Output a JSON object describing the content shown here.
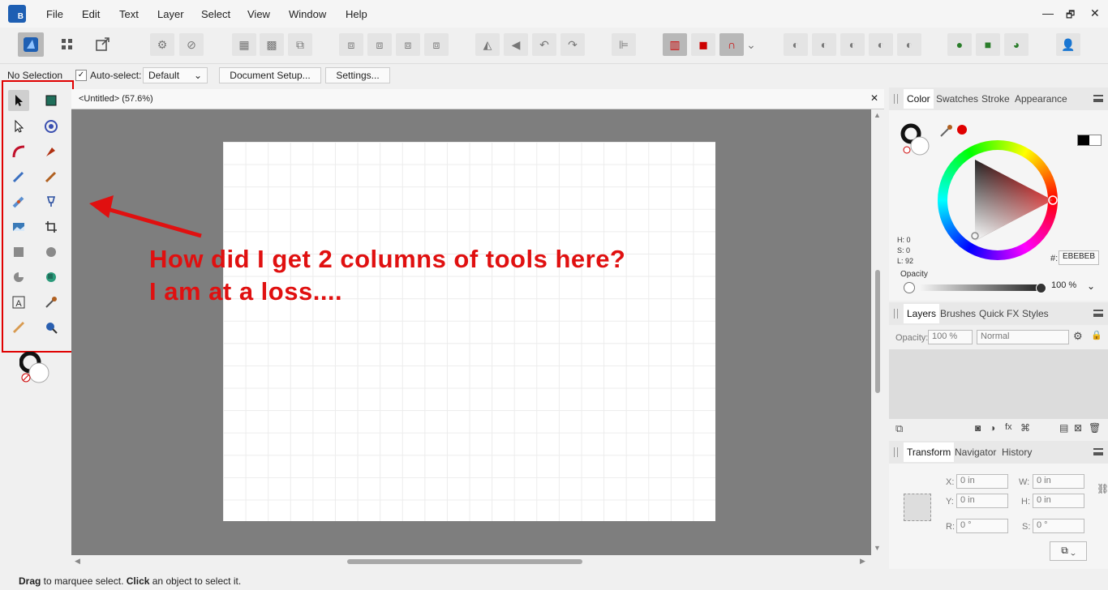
{
  "menu": [
    "File",
    "Edit",
    "Text",
    "Layer",
    "Select",
    "View",
    "Window",
    "Help"
  ],
  "window_controls": {
    "minimize": "—",
    "restore": "🗗",
    "close": "✕"
  },
  "context_bar": {
    "selection": "No Selection",
    "auto_select_label": "Auto-select:",
    "auto_select_value": "Default",
    "document_setup": "Document Setup...",
    "settings": "Settings..."
  },
  "document": {
    "tab_title": "<Untitled>  (57.6%)",
    "close": "✕"
  },
  "annotation": {
    "line1": "How did I get 2 columns of tools here?",
    "line2": "I am at a loss...."
  },
  "status": {
    "drag": "Drag",
    "text1": " to marquee select. ",
    "click": "Click",
    "text2": " an object to select it."
  },
  "color_panel": {
    "tabs": [
      "Color",
      "Swatches",
      "Stroke",
      "Appearance"
    ],
    "h": "H: 0",
    "s": "S: 0",
    "l": "L: 92",
    "hex_label": "#:",
    "hex_value": "EBEBEB",
    "opacity_label": "Opacity",
    "opacity_value": "100 %"
  },
  "layers_panel": {
    "tabs": [
      "Layers",
      "Brushes",
      "Quick FX",
      "Styles"
    ],
    "opacity_label": "Opacity:",
    "opacity_value": "100 %",
    "blend_mode": "Normal"
  },
  "transform_panel": {
    "tabs": [
      "Transform",
      "Navigator",
      "History"
    ],
    "x_label": "X:",
    "x_value": "0 in",
    "y_label": "Y:",
    "y_value": "0 in",
    "w_label": "W:",
    "w_value": "0 in",
    "h_label": "H:",
    "h_value": "0 in",
    "r_label": "R:",
    "r_value": "0 °",
    "s_label": "S:",
    "s_value": "0 °"
  },
  "colors": {
    "accent": "#1e5fb3",
    "annotation": "#e01010",
    "canvas_bg": "#7e7e7e"
  }
}
